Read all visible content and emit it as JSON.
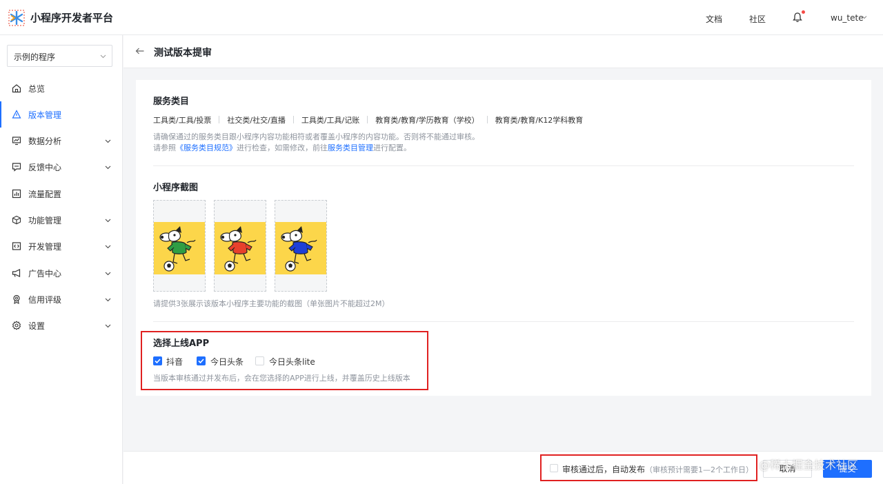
{
  "header": {
    "brand": "小程序开发者平台",
    "links": [
      "文档",
      "社区"
    ],
    "user": "wu_tete"
  },
  "sidebar": {
    "app_selector": "示例的程序",
    "items": [
      {
        "label": "总览",
        "icon": "home-icon"
      },
      {
        "label": "版本管理",
        "icon": "version-icon",
        "active": true
      },
      {
        "label": "数据分析",
        "icon": "chart-icon",
        "expandable": true
      },
      {
        "label": "反馈中心",
        "icon": "feedback-icon",
        "expandable": true
      },
      {
        "label": "流量配置",
        "icon": "traffic-icon"
      },
      {
        "label": "功能管理",
        "icon": "cube-icon",
        "expandable": true
      },
      {
        "label": "开发管理",
        "icon": "code-icon",
        "expandable": true
      },
      {
        "label": "广告中心",
        "icon": "megaphone-icon",
        "expandable": true
      },
      {
        "label": "信用评级",
        "icon": "badge-icon",
        "expandable": true
      },
      {
        "label": "设置",
        "icon": "gear-icon",
        "expandable": true
      }
    ]
  },
  "page": {
    "title": "测试版本提审"
  },
  "service_category": {
    "title": "服务类目",
    "categories": [
      "工具类/工具/投票",
      "社交类/社交/直播",
      "工具类/工具/记账",
      "教育类/教育/学历教育（学校）",
      "教育类/教育/K12学科教育"
    ],
    "hint1": "请确保通过的服务类目跟小程序内容功能相符或者覆盖小程序的内容功能。否则将不能通过审核。",
    "hint2_prefix": "请参照",
    "hint2_link1": "《服务类目规范》",
    "hint2_middle": "进行检查，如需修改，前往",
    "hint2_link2": "服务类目管理",
    "hint2_suffix": "进行配置。"
  },
  "screenshots": {
    "title": "小程序截图",
    "shirts": [
      "#2f9e44",
      "#e8412c",
      "#1e3fd8"
    ],
    "hint": "请提供3张展示该版本小程序主要功能的截图（单张图片不能超过2M）"
  },
  "apps": {
    "title": "选择上线APP",
    "options": [
      {
        "label": "抖音",
        "checked": true
      },
      {
        "label": "今日头条",
        "checked": true
      },
      {
        "label": "今日头条lite",
        "checked": false
      }
    ],
    "hint": "当版本审核通过并发布后，会在您选择的APP进行上线，并覆盖历史上线版本"
  },
  "footer": {
    "auto_publish_label": "审核通过后，自动发布",
    "auto_publish_note": "（审核预计需要1—2个工作日）",
    "cancel": "取消",
    "submit": "提交",
    "watermark": "@稀土掘金技术社区"
  },
  "colors": {
    "accent": "#1e6fff",
    "highlight_border": "#e02020"
  }
}
